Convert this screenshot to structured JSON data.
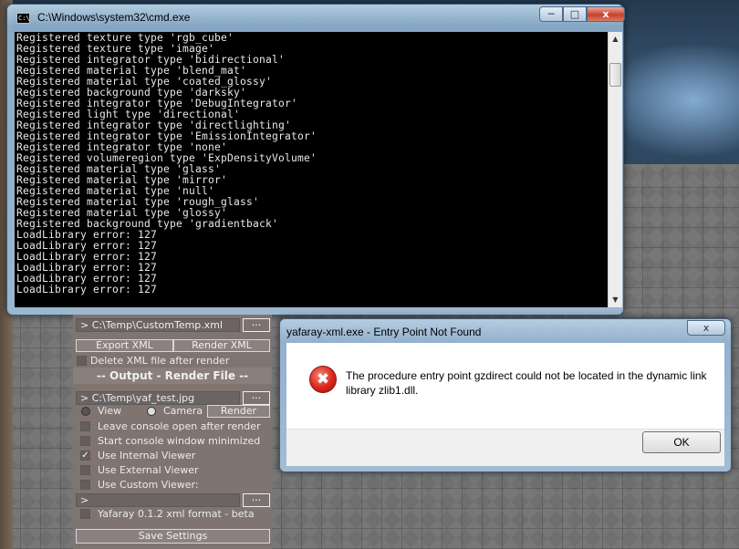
{
  "console": {
    "title": "C:\\Windows\\system32\\cmd.exe",
    "icon_text": "C:\\",
    "controls": {
      "minimize": "─",
      "maximize": "□",
      "close": "x"
    },
    "lines": [
      "Registered texture type 'rgb_cube'",
      "Registered texture type 'image'",
      "Registered integrator type 'bidirectional'",
      "Registered material type 'blend_mat'",
      "Registered material type 'coated_glossy'",
      "Registered background type 'darksky'",
      "Registered integrator type 'DebugIntegrator'",
      "Registered light type 'directional'",
      "Registered integrator type 'directlighting'",
      "Registered integrator type 'EmissionIntegrator'",
      "Registered integrator type 'none'",
      "Registered volumeregion type 'ExpDensityVolume'",
      "Registered material type 'glass'",
      "Registered material type 'mirror'",
      "Registered material type 'null'",
      "Registered material type 'rough_glass'",
      "Registered material type 'glossy'",
      "Registered background type 'gradientback'",
      "LoadLibrary error: 127",
      "LoadLibrary error: 127",
      "LoadLibrary error: 127",
      "LoadLibrary error: 127",
      "LoadLibrary error: 127",
      "LoadLibrary error: 127"
    ],
    "scroll_up": "▲",
    "scroll_down": "▼"
  },
  "panel": {
    "xml_path": "> C:\\Temp\\CustomTemp.xml",
    "browse": "...",
    "export_xml": "Export XML",
    "render_xml": "Render XML",
    "delete_xml": "Delete XML file after render",
    "output_header": "-- Output - Render File --",
    "output_path": "> C:\\Temp\\yaf_test.jpg",
    "radio_view": "View",
    "radio_camera": "Camera",
    "render": "Render",
    "options": [
      {
        "label": "Leave console open after render",
        "checked": false
      },
      {
        "label": "Start console window minimized",
        "checked": false
      },
      {
        "label": "Use Internal Viewer",
        "checked": true
      },
      {
        "label": "Use External Viewer",
        "checked": false
      },
      {
        "label": "Use Custom Viewer:",
        "checked": false
      }
    ],
    "custom_path": ">",
    "format": "Yafaray 0.1.2 xml format - beta",
    "save_settings": "Save Settings",
    "check_mark": "✓"
  },
  "dialog": {
    "title": "yafaray-xml.exe - Entry Point Not Found",
    "close": "x",
    "icon_glyph": "✖",
    "message": "The procedure entry point gzdirect could not be located in the dynamic link library zlib1.dll.",
    "ok": "OK"
  }
}
